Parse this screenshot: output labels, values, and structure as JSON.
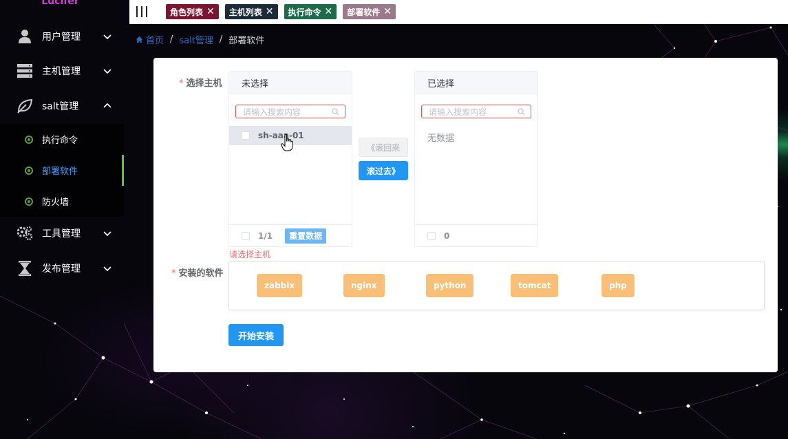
{
  "app": {
    "logo": "Lucifer"
  },
  "sidebar": {
    "menus": [
      {
        "label": "用户管理",
        "icon": "user-icon",
        "expanded": false
      },
      {
        "label": "主机管理",
        "icon": "server-icon",
        "expanded": false
      },
      {
        "label": "salt管理",
        "icon": "leaf-icon",
        "expanded": true
      },
      {
        "label": "工具管理",
        "icon": "gears-icon",
        "expanded": false
      },
      {
        "label": "发布管理",
        "icon": "hourglass-icon",
        "expanded": false
      }
    ],
    "salt_sub": [
      {
        "label": "执行命令"
      },
      {
        "label": "部署软件",
        "active": true
      },
      {
        "label": "防火墙"
      }
    ]
  },
  "tags": [
    {
      "label": "角色列表",
      "color": "#7b1532"
    },
    {
      "label": "主机列表",
      "color": "#1c2b3a"
    },
    {
      "label": "执行命令",
      "color": "#1d6b4a"
    },
    {
      "label": "部署软件",
      "color": "#9a7a8a"
    }
  ],
  "breadcrumb": {
    "home": "首页",
    "parent": "salt管理",
    "current": "部署软件"
  },
  "form": {
    "host_label": "选择主机",
    "software_label": "安装的软件",
    "host_error": "请选择主机",
    "left_panel": {
      "title": "未选择",
      "search_placeholder": "请输入搜索内容",
      "items": [
        "sh-aaa-01"
      ],
      "count": "1/1",
      "reset_label": "重置数据"
    },
    "right_panel": {
      "title": "已选择",
      "search_placeholder": "请输入搜索内容",
      "empty": "无数据",
      "count": "0"
    },
    "btn_back": "《滚回来",
    "btn_forward": "滚过去》",
    "software": [
      "zabbix",
      "nginx",
      "python",
      "tomcat",
      "php"
    ],
    "install_label": "开始安装"
  },
  "colors": {
    "primary": "#2196f3",
    "chip": "#f9bf76",
    "error": "#f56c6c",
    "active_menu": "#409eff"
  }
}
